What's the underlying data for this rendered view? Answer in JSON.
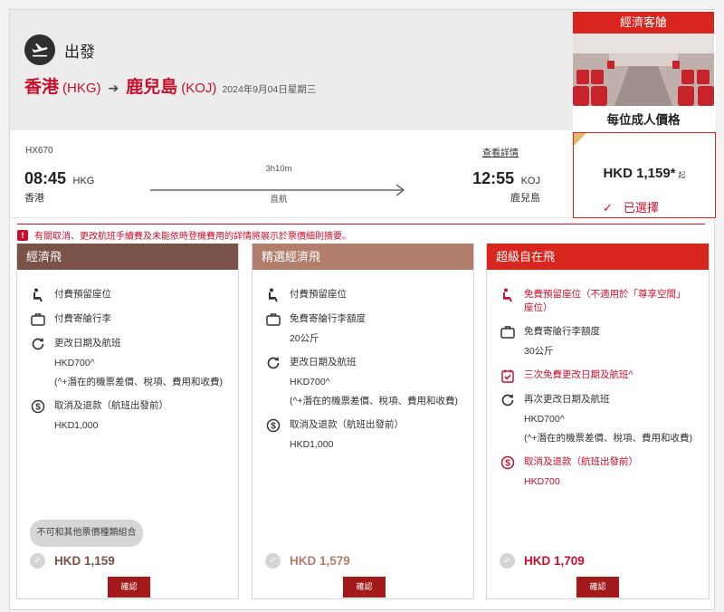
{
  "header": {
    "title": "出發",
    "origin_city": "香港",
    "origin_code": "(HKG)",
    "dest_city": "鹿兒島",
    "dest_code": "(KOJ)",
    "date": "2024年9月04日星期三"
  },
  "cabin": {
    "title": "經濟客艙",
    "label": "每位成人價格"
  },
  "flight": {
    "number": "HX670",
    "details_link": "查看詳情",
    "dep_time": "08:45",
    "dep_code": "HKG",
    "dep_city": "香港",
    "arr_time": "12:55",
    "arr_code": "KOJ",
    "arr_city": "鹿兒島",
    "duration": "3h10m",
    "stops": "直航"
  },
  "price_box": {
    "amount": "HKD 1,159*",
    "from": "起",
    "selected": "已選擇"
  },
  "notice": "有關取消、更改航班手續費及未能依時登機費用的詳情將展示於票價細則摘要。",
  "fares": [
    {
      "title": "經濟飛",
      "header_color": "#7a5248",
      "seat": "付費預留座位",
      "bag": "付費寄艙行李",
      "change": "更改日期及航班",
      "change_fee": "HKD700^",
      "change_note": "(^+潛在的機票差價、稅項、費用和收費)",
      "refund": "取消及退款（航班出發前）",
      "refund_fee": "HKD1,000",
      "combo_note": "不可和其他票價種類組合",
      "price": "HKD 1,159",
      "price_color": "#7a5248",
      "confirm": "確認"
    },
    {
      "title": "精選經濟飛",
      "header_color": "#b27e6c",
      "seat": "付費預留座位",
      "bag": "免費寄艙行李額度",
      "bag_weight": "20公斤",
      "change": "更改日期及航班",
      "change_fee": "HKD700^",
      "change_note": "(^+潛在的機票差價、稅項、費用和收費)",
      "refund": "取消及退款（航班出發前）",
      "refund_fee": "HKD1,000",
      "price": "HKD 1,579",
      "price_color": "#b27e6c",
      "confirm": "確認"
    },
    {
      "title": "超級自在飛",
      "header_color": "#d8261f",
      "seat": "免費預留座位（不適用於「尊享空間」座位）",
      "bag": "免費寄艙行李額度",
      "bag_weight": "30公斤",
      "free_change": "三次免費更改日期及航班^",
      "change": "再次更改日期及航班",
      "change_fee": "HKD700^",
      "change_note": "(^+潛在的機票差價、稅項、費用和收費)",
      "refund": "取消及退款（航班出發前）",
      "refund_fee": "HKD700",
      "price": "HKD 1,709",
      "price_color": "#c8102e",
      "confirm": "確認"
    }
  ]
}
